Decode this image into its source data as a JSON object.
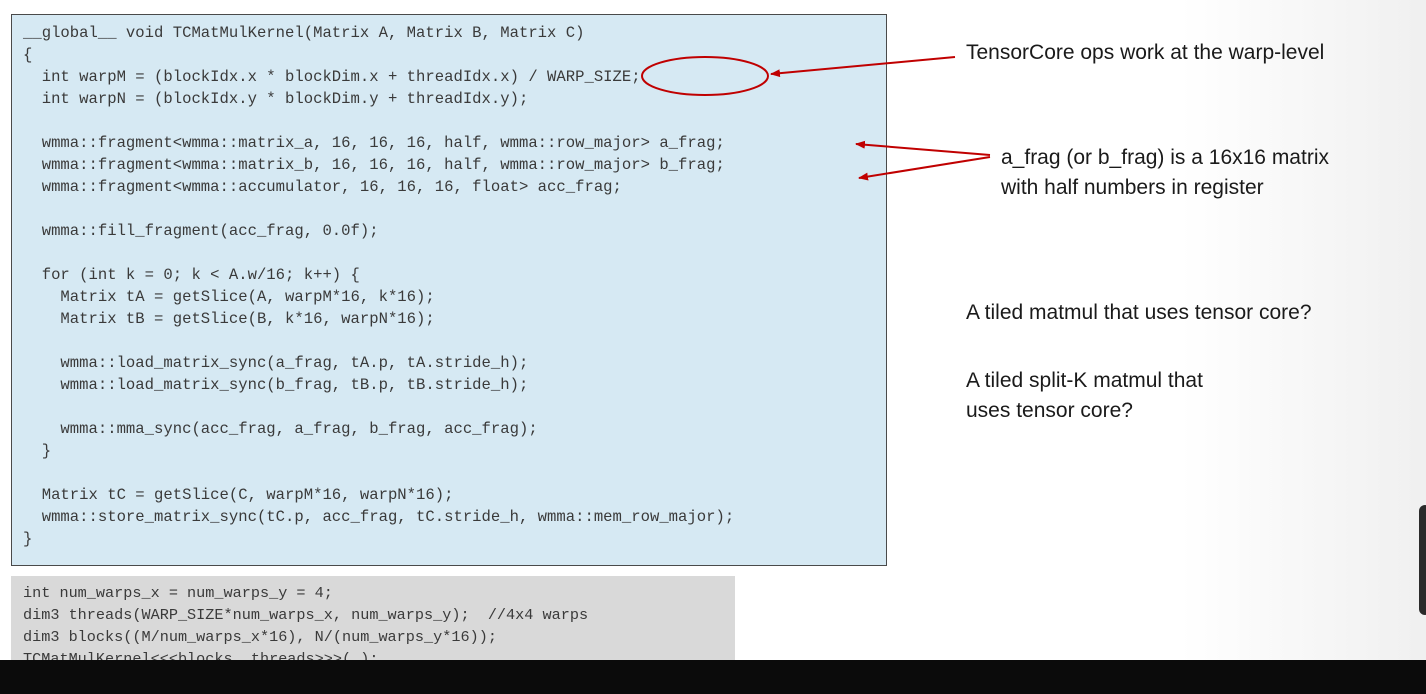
{
  "kernel_code": "__global__ void TCMatMulKernel(Matrix A, Matrix B, Matrix C)\n{\n  int warpM = (blockIdx.x * blockDim.x + threadIdx.x) / WARP_SIZE;\n  int warpN = (blockIdx.y * blockDim.y + threadIdx.y);\n\n  wmma::fragment<wmma::matrix_a, 16, 16, 16, half, wmma::row_major> a_frag;\n  wmma::fragment<wmma::matrix_b, 16, 16, 16, half, wmma::row_major> b_frag;\n  wmma::fragment<wmma::accumulator, 16, 16, 16, float> acc_frag;\n\n  wmma::fill_fragment(acc_frag, 0.0f);\n\n  for (int k = 0; k < A.w/16; k++) {\n    Matrix tA = getSlice(A, warpM*16, k*16);\n    Matrix tB = getSlice(B, k*16, warpN*16);\n\n    wmma::load_matrix_sync(a_frag, tA.p, tA.stride_h);\n    wmma::load_matrix_sync(b_frag, tB.p, tB.stride_h);\n\n    wmma::mma_sync(acc_frag, a_frag, b_frag, acc_frag);\n  }\n\n  Matrix tC = getSlice(C, warpM*16, warpN*16);\n  wmma::store_matrix_sync(tC.p, acc_frag, tC.stride_h, wmma::mem_row_major);\n}",
  "launch_code": "int num_warps_x = num_warps_y = 4;\ndim3 threads(WARP_SIZE*num_warps_x, num_warps_y);  //4x4 warps\ndim3 blocks((M/num_warps_x*16), N/(num_warps_y*16));\nTCMatMulKernel<<<blocks, threads>>>(…);",
  "annotations": {
    "warp_level": "TensorCore ops work at the warp-level",
    "frag_line1": "a_frag (or b_frag) is a 16x16 matrix",
    "frag_line2": "with half numbers in register"
  },
  "questions": {
    "q1": "A tiled matmul that uses tensor core?",
    "q2_line1": "A tiled split-K matmul that",
    "q2_line2": "uses tensor core?"
  },
  "colors": {
    "code_background": "#d6e9f3",
    "launch_background": "#d9d9d9",
    "annotation_red": "#c00000"
  }
}
